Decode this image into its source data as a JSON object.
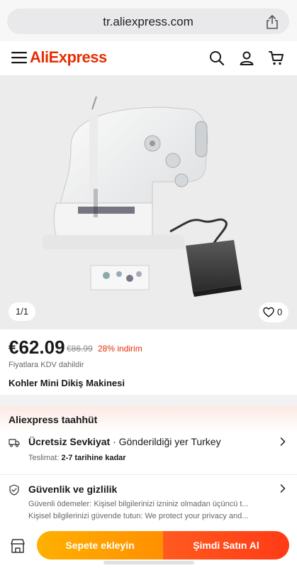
{
  "browser": {
    "url": "tr.aliexpress.com"
  },
  "header": {
    "logo_prefix": "Ali",
    "logo_suffix": "Express"
  },
  "gallery": {
    "page_indicator": "1/1",
    "favorites_count": "0"
  },
  "price": {
    "current": "€62.09",
    "original": "€86.99",
    "discount": "28% indirim",
    "tax_note": "Fiyatlara KDV dahildir"
  },
  "product": {
    "title": "Kohler Mini Dikiş Makinesi"
  },
  "commitment": {
    "title": "Aliexpress taahhüt",
    "shipping": {
      "title": "Ücretsiz Sevkiyat",
      "destination": " · Gönderildiği yer Turkey",
      "delivery_label": "Teslimat: ",
      "delivery_value": "2-7 tarihine kadar"
    },
    "security": {
      "title": "Güvenlik ve gizlilik",
      "line1": "Güvenli ödemeler: Kişisel bilgilerinizi izniniz olmadan üçüncü t...",
      "line2": "Kişisel bilgilerinizi güvende tutun: We protect your privacy and..."
    }
  },
  "actions": {
    "add_to_cart": "Sepete ekleyin",
    "buy_now": "Şimdi Satın Al"
  },
  "colors": {
    "brand": "#e62e04",
    "cart_button": "#ff9f00",
    "buy_button": "#ff4b1a"
  }
}
